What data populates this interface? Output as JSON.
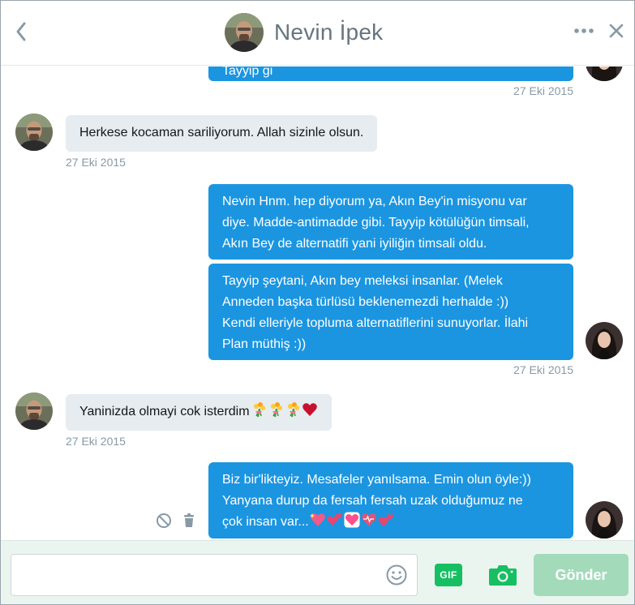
{
  "header": {
    "title": "Nevin İpek"
  },
  "messages": [
    {
      "direction": "out",
      "lines": [
        "Tayyip gi"
      ],
      "timestamp": "27 Eki 2015"
    },
    {
      "direction": "in",
      "lines": [
        "Herkese kocaman sariliyorum. Allah sizinle olsun."
      ],
      "timestamp": "27 Eki 2015"
    },
    {
      "direction": "out",
      "lines": [
        "Nevin Hnm. hep diyorum ya, Akın Bey'in misyonu var",
        "diye. Madde-antimadde gibi. Tayyip kötülüğün timsali,",
        "Akın Bey de alternatifi yani iyiliğin timsali oldu."
      ]
    },
    {
      "direction": "out",
      "lines": [
        "Tayyip şeytani, Akın bey meleksi insanlar. (Melek",
        "Anneden başka türlüsü beklenemezdi herhalde :))",
        "Kendi elleriyle topluma alternatiflerini sunuyorlar. İlahi",
        "Plan müthiş :))"
      ],
      "timestamp": "27 Eki 2015"
    },
    {
      "direction": "in",
      "lines": [
        "Yaninizda olmayi cok isterdim"
      ],
      "emoji": [
        "bouquet",
        "bouquet",
        "bouquet",
        "red-heart"
      ],
      "timestamp": "27 Eki 2015"
    },
    {
      "direction": "out",
      "lines": [
        "Biz bir'likteyiz. Mesafeler yanılsama. Emin olun öyle:))",
        "Yanyana durup da fersah fersah uzak olduğumuz ne",
        "çok insan var..."
      ],
      "emoji": [
        "sparkling-heart",
        "revolving-hearts",
        "heart-ribbon",
        "heartbeat",
        "two-hearts"
      ]
    }
  ],
  "composer": {
    "placeholder": "",
    "gif_label": "GIF",
    "send_label": "Gönder"
  },
  "colors": {
    "outgoing_bubble": "#1b95e0",
    "incoming_bubble": "#e6ecf0",
    "composer_bg": "#ebf5f0",
    "send_button": "#a3dbba",
    "gif_button": "#17bf63"
  },
  "icons": [
    "back-icon",
    "more-icon",
    "close-icon",
    "report-icon",
    "trash-icon",
    "smiley-icon",
    "camera-icon"
  ]
}
